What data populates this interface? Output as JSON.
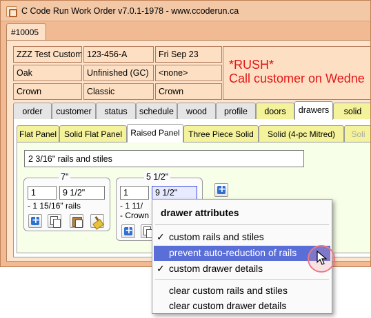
{
  "window": {
    "title": "C Code Run Work Order v7.0.1-1978 - www.ccoderun.ca"
  },
  "doc_tab": "#10005",
  "info": {
    "customer": "ZZZ Test Customer",
    "phone": "123-456-A",
    "date": "Fri Sep 23",
    "wood": "Oak",
    "finish": "Unfinished (GC)",
    "none_value": "<none>",
    "profile": "Crown",
    "style": "Classic",
    "profile2": "Crown",
    "rush_line1": "*RUSH*",
    "rush_line2": "Call customer on Wedne"
  },
  "main_tabs": [
    "order",
    "customer",
    "status",
    "schedule",
    "wood",
    "profile",
    "doors",
    "drawers",
    "solid"
  ],
  "sub_tabs": [
    "Flat Panel",
    "Solid Flat Panel",
    "Raised Panel",
    "Three Piece Solid",
    "Solid (4-pc Mitred)",
    "Soli"
  ],
  "rails_value": "2 3/16\" rails and stiles",
  "groups": [
    {
      "width_label": "7\"",
      "qty": "1",
      "height": "9 1/2\"",
      "note": "- 1 15/16\" rails"
    },
    {
      "width_label": "5 1/2\"",
      "qty": "1",
      "height": "9 1/2\"",
      "note": "- 1 11/",
      "note2": "- Crown"
    }
  ],
  "menu": {
    "header": "drawer attributes",
    "items": [
      {
        "label": "custom rails and stiles",
        "checked": "✓"
      },
      {
        "label": "prevent auto-reduction of rails",
        "checked": ""
      },
      {
        "label": "custom drawer details",
        "checked": "✓"
      },
      {
        "label": "clear custom rails and stiles",
        "checked": ""
      },
      {
        "label": "clear custom drawer details",
        "checked": ""
      }
    ]
  },
  "colors": {
    "window_bg": "#f2ba93",
    "highlight": "#5a6ed8",
    "rush_text": "#e31515",
    "tab_yellow": "#f4f29a"
  },
  "icons": [
    "app-icon",
    "add-icon",
    "copy-icon",
    "paste-icon",
    "broom-icon",
    "mouse-cursor-icon"
  ]
}
